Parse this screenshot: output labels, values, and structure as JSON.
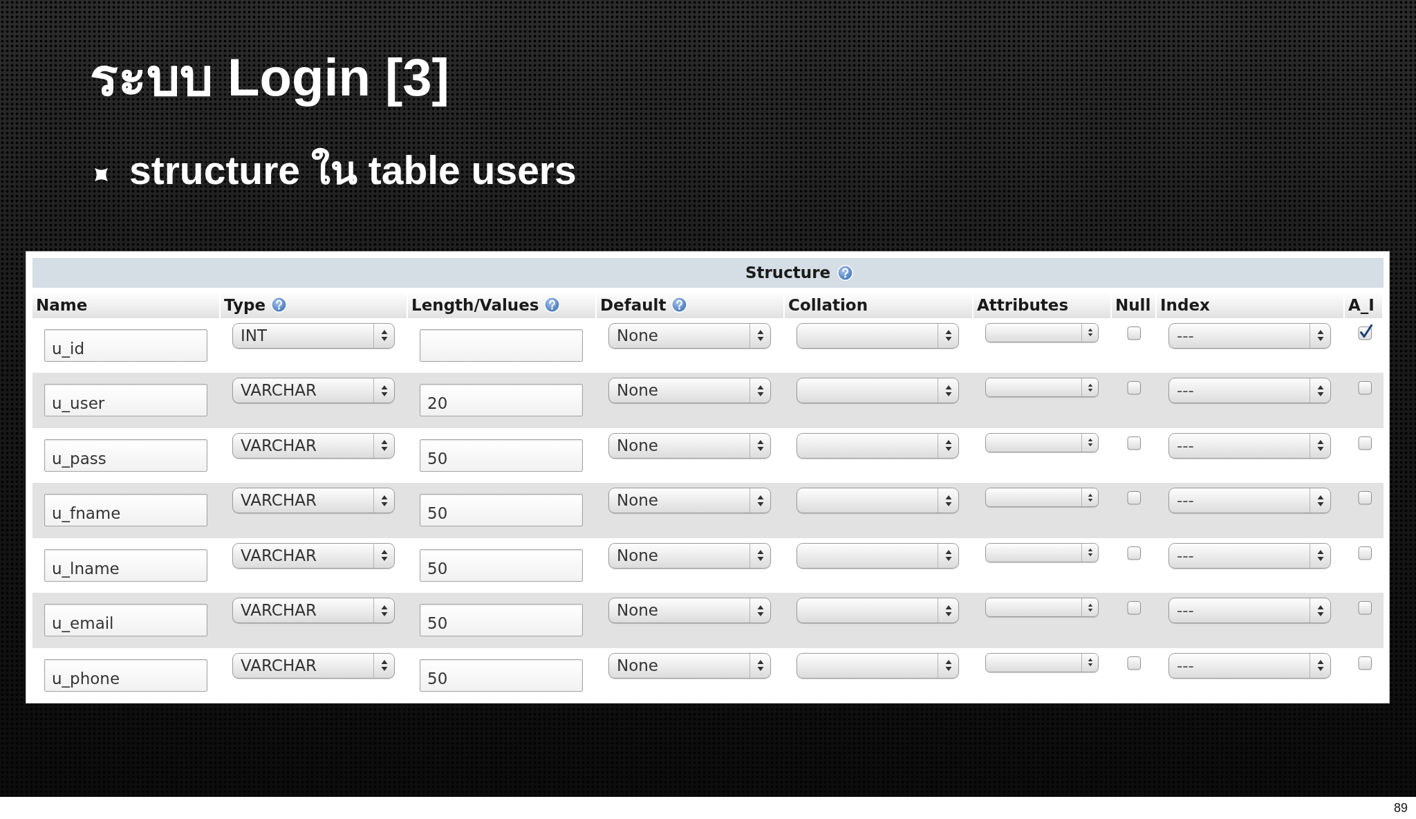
{
  "slide": {
    "title": "ระบบ Login [3]",
    "bullets": [
      "structure ใน table users"
    ]
  },
  "structure_table": {
    "title": "Structure",
    "columns": [
      {
        "label": "Name",
        "help": false
      },
      {
        "label": "Type",
        "help": true
      },
      {
        "label": "Length/Values",
        "help": true
      },
      {
        "label": "Default",
        "help": true
      },
      {
        "label": "Collation",
        "help": false
      },
      {
        "label": "Attributes",
        "help": false
      },
      {
        "label": "Null",
        "help": false
      },
      {
        "label": "Index",
        "help": false
      },
      {
        "label": "A_I",
        "help": false
      }
    ],
    "rows": [
      {
        "name": "u_id",
        "type": "INT",
        "default": "None",
        "null": false,
        "index": "---",
        "a_i": true
      },
      {
        "name": "u_user",
        "type": "VARCHAR",
        "length": "20",
        "default": "None",
        "null": false,
        "index": "---",
        "a_i": false
      },
      {
        "name": "u_pass",
        "type": "VARCHAR",
        "length": "50",
        "default": "None",
        "null": false,
        "index": "---",
        "a_i": false
      },
      {
        "name": "u_fname",
        "type": "VARCHAR",
        "length": "50",
        "default": "None",
        "null": false,
        "index": "---",
        "a_i": false
      },
      {
        "name": "u_lname",
        "type": "VARCHAR",
        "length": "50",
        "default": "None",
        "null": false,
        "index": "---",
        "a_i": false
      },
      {
        "name": "u_email",
        "type": "VARCHAR",
        "length": "50",
        "default": "None",
        "null": false,
        "index": "---",
        "a_i": false
      },
      {
        "name": "u_phone",
        "type": "VARCHAR",
        "length": "50",
        "default": "None",
        "null": false,
        "index": "---",
        "a_i": false
      }
    ]
  },
  "page_number": "89"
}
